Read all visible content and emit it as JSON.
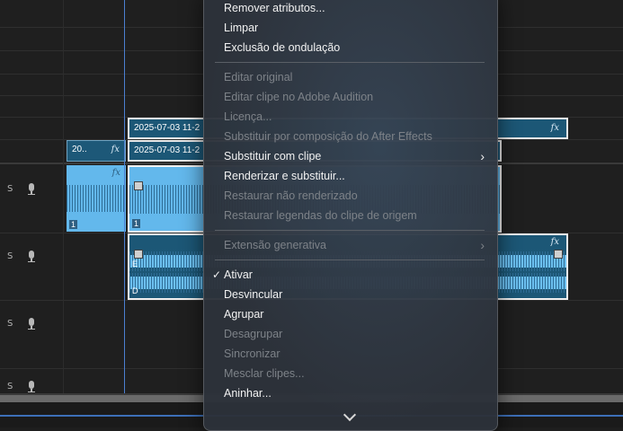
{
  "tracks": {
    "audio_rows": [
      {
        "label": "S"
      },
      {
        "label": "S"
      },
      {
        "label": "S"
      },
      {
        "label": "S"
      }
    ]
  },
  "clips": {
    "v2_label": "2025-07-03 11-2",
    "v2_fx": "fx",
    "v1_short_label": "20..",
    "v1_short_fx": "fx",
    "v1_label": "2025-07-03 11-2",
    "a1_left_fx": "fx",
    "a1_left_num": "1",
    "a1_main_num": "1",
    "a2_fx": "fx",
    "a2_lane_e": "E",
    "a2_lane_d": "D"
  },
  "menu": {
    "items": [
      {
        "label": "Remover atributos...",
        "enabled": true
      },
      {
        "label": "Limpar",
        "enabled": true
      },
      {
        "label": "Exclusão de ondulação",
        "enabled": true
      },
      {
        "label": "Editar original",
        "enabled": false
      },
      {
        "label": "Editar clipe no Adobe Audition",
        "enabled": false
      },
      {
        "label": "Licença...",
        "enabled": false
      },
      {
        "label": "Substituir por composição do After Effects",
        "enabled": false
      },
      {
        "label": "Substituir com clipe",
        "enabled": true,
        "submenu": true
      },
      {
        "label": "Renderizar e substituir...",
        "enabled": true
      },
      {
        "label": "Restaurar não renderizado",
        "enabled": false
      },
      {
        "label": "Restaurar legendas do clipe de origem",
        "enabled": false
      },
      {
        "label": "Extensão generativa",
        "enabled": false,
        "submenu": true
      },
      {
        "label": "Ativar",
        "enabled": true,
        "checked": true
      },
      {
        "label": "Desvincular",
        "enabled": true
      },
      {
        "label": "Agrupar",
        "enabled": true
      },
      {
        "label": "Desagrupar",
        "enabled": false
      },
      {
        "label": "Sincronizar",
        "enabled": false
      },
      {
        "label": "Mesclar clipes...",
        "enabled": false
      },
      {
        "label": "Aninhar...",
        "enabled": true
      }
    ],
    "check_glyph": "✓",
    "submenu_glyph": "›"
  },
  "colors": {
    "clip_video": "#1c5776",
    "clip_audio": "#63b8ec",
    "playhead": "#4b7fd1",
    "menu_bg": "#2c323a"
  }
}
